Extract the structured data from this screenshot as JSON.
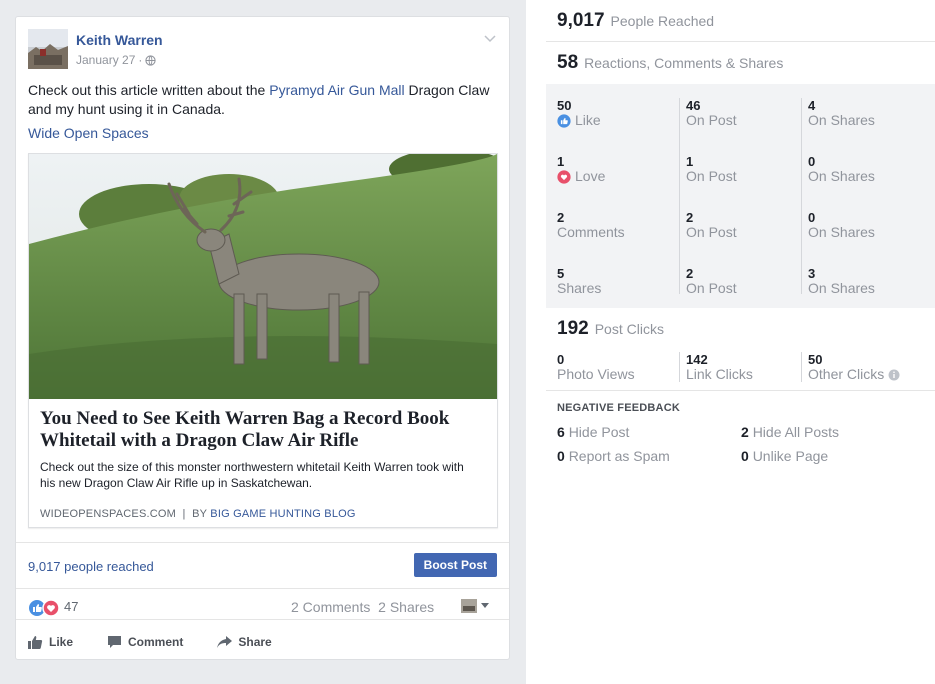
{
  "post": {
    "author": "Keith Warren",
    "date": "January 27",
    "text_before": "Check out this article written about the ",
    "text_link": "Pyramyd Air Gun Mall",
    "text_after": " Dragon Claw and my hunt using it in Canada.",
    "source_link": "Wide Open Spaces",
    "attachment": {
      "title": "You Need to See Keith Warren Bag a Record Book Whitetail with a Dragon Claw Air Rifle",
      "description": "Check out the size of this monster northwestern whitetail Keith Warren took with his new Dragon Claw Air Rifle up in Saskatchewan.",
      "domain": "WIDEOPENSPACES.COM",
      "by_prefix": "BY",
      "by_name": "BIG GAME HUNTING BLOG"
    },
    "people_reached": "9,017 people reached",
    "boost_label": "Boost Post",
    "reaction_count": "47",
    "comments_label": "2 Comments",
    "shares_label": "2 Shares",
    "actions": {
      "like": "Like",
      "comment": "Comment",
      "share": "Share"
    }
  },
  "insights": {
    "reached": {
      "value": "9,017",
      "label": "People Reached"
    },
    "engagement": {
      "value": "58",
      "label": "Reactions, Comments & Shares"
    },
    "grid": [
      [
        {
          "n": "50",
          "t": "Like",
          "icon": "like"
        },
        {
          "n": "46",
          "t": "On Post"
        },
        {
          "n": "4",
          "t": "On Shares"
        }
      ],
      [
        {
          "n": "1",
          "t": "Love",
          "icon": "love"
        },
        {
          "n": "1",
          "t": "On Post"
        },
        {
          "n": "0",
          "t": "On Shares"
        }
      ],
      [
        {
          "n": "2",
          "t": "Comments"
        },
        {
          "n": "2",
          "t": "On Post"
        },
        {
          "n": "0",
          "t": "On Shares"
        }
      ],
      [
        {
          "n": "5",
          "t": "Shares"
        },
        {
          "n": "2",
          "t": "On Post"
        },
        {
          "n": "3",
          "t": "On Shares"
        }
      ]
    ],
    "post_clicks": {
      "value": "192",
      "label": "Post Clicks"
    },
    "clicks": [
      {
        "n": "0",
        "t": "Photo Views"
      },
      {
        "n": "142",
        "t": "Link Clicks"
      },
      {
        "n": "50",
        "t": "Other Clicks"
      }
    ],
    "negative_title": "NEGATIVE FEEDBACK",
    "negative": [
      {
        "n": "6",
        "t": "Hide Post"
      },
      {
        "n": "2",
        "t": "Hide All Posts"
      },
      {
        "n": "0",
        "t": "Report as Spam"
      },
      {
        "n": "0",
        "t": "Unlike Page"
      }
    ]
  },
  "colors": {
    "link": "#365899",
    "boost": "#4267b2",
    "like": "#4a90e2",
    "love": "#e8506a"
  }
}
